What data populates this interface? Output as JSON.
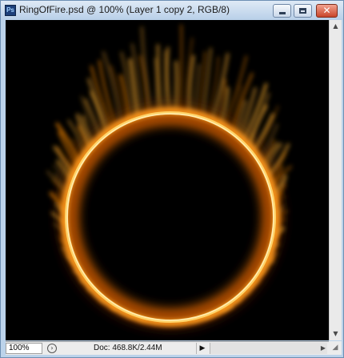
{
  "window": {
    "title": "RingOfFire.psd @ 100% (Layer 1 copy 2, RGB/8)",
    "app_icon_label": "Ps",
    "minimize_glyph": "",
    "maximize_glyph": "",
    "close_glyph": "✕"
  },
  "canvas": {
    "background_color": "#000000",
    "ring_color": "#ffe08a",
    "flame_color": "#ff8c00",
    "image_content": "ring-of-fire"
  },
  "scrollbar": {
    "up_arrow": "▲",
    "down_arrow": "▼",
    "right_arrow": "▶"
  },
  "status": {
    "zoom": "100%",
    "doc_info": "Doc: 468.8K/2.44M",
    "menu_arrow": "▶",
    "grip": "◢"
  },
  "colors": {
    "window_frame": "#bcd3ea",
    "close_button": "#c8452a"
  }
}
